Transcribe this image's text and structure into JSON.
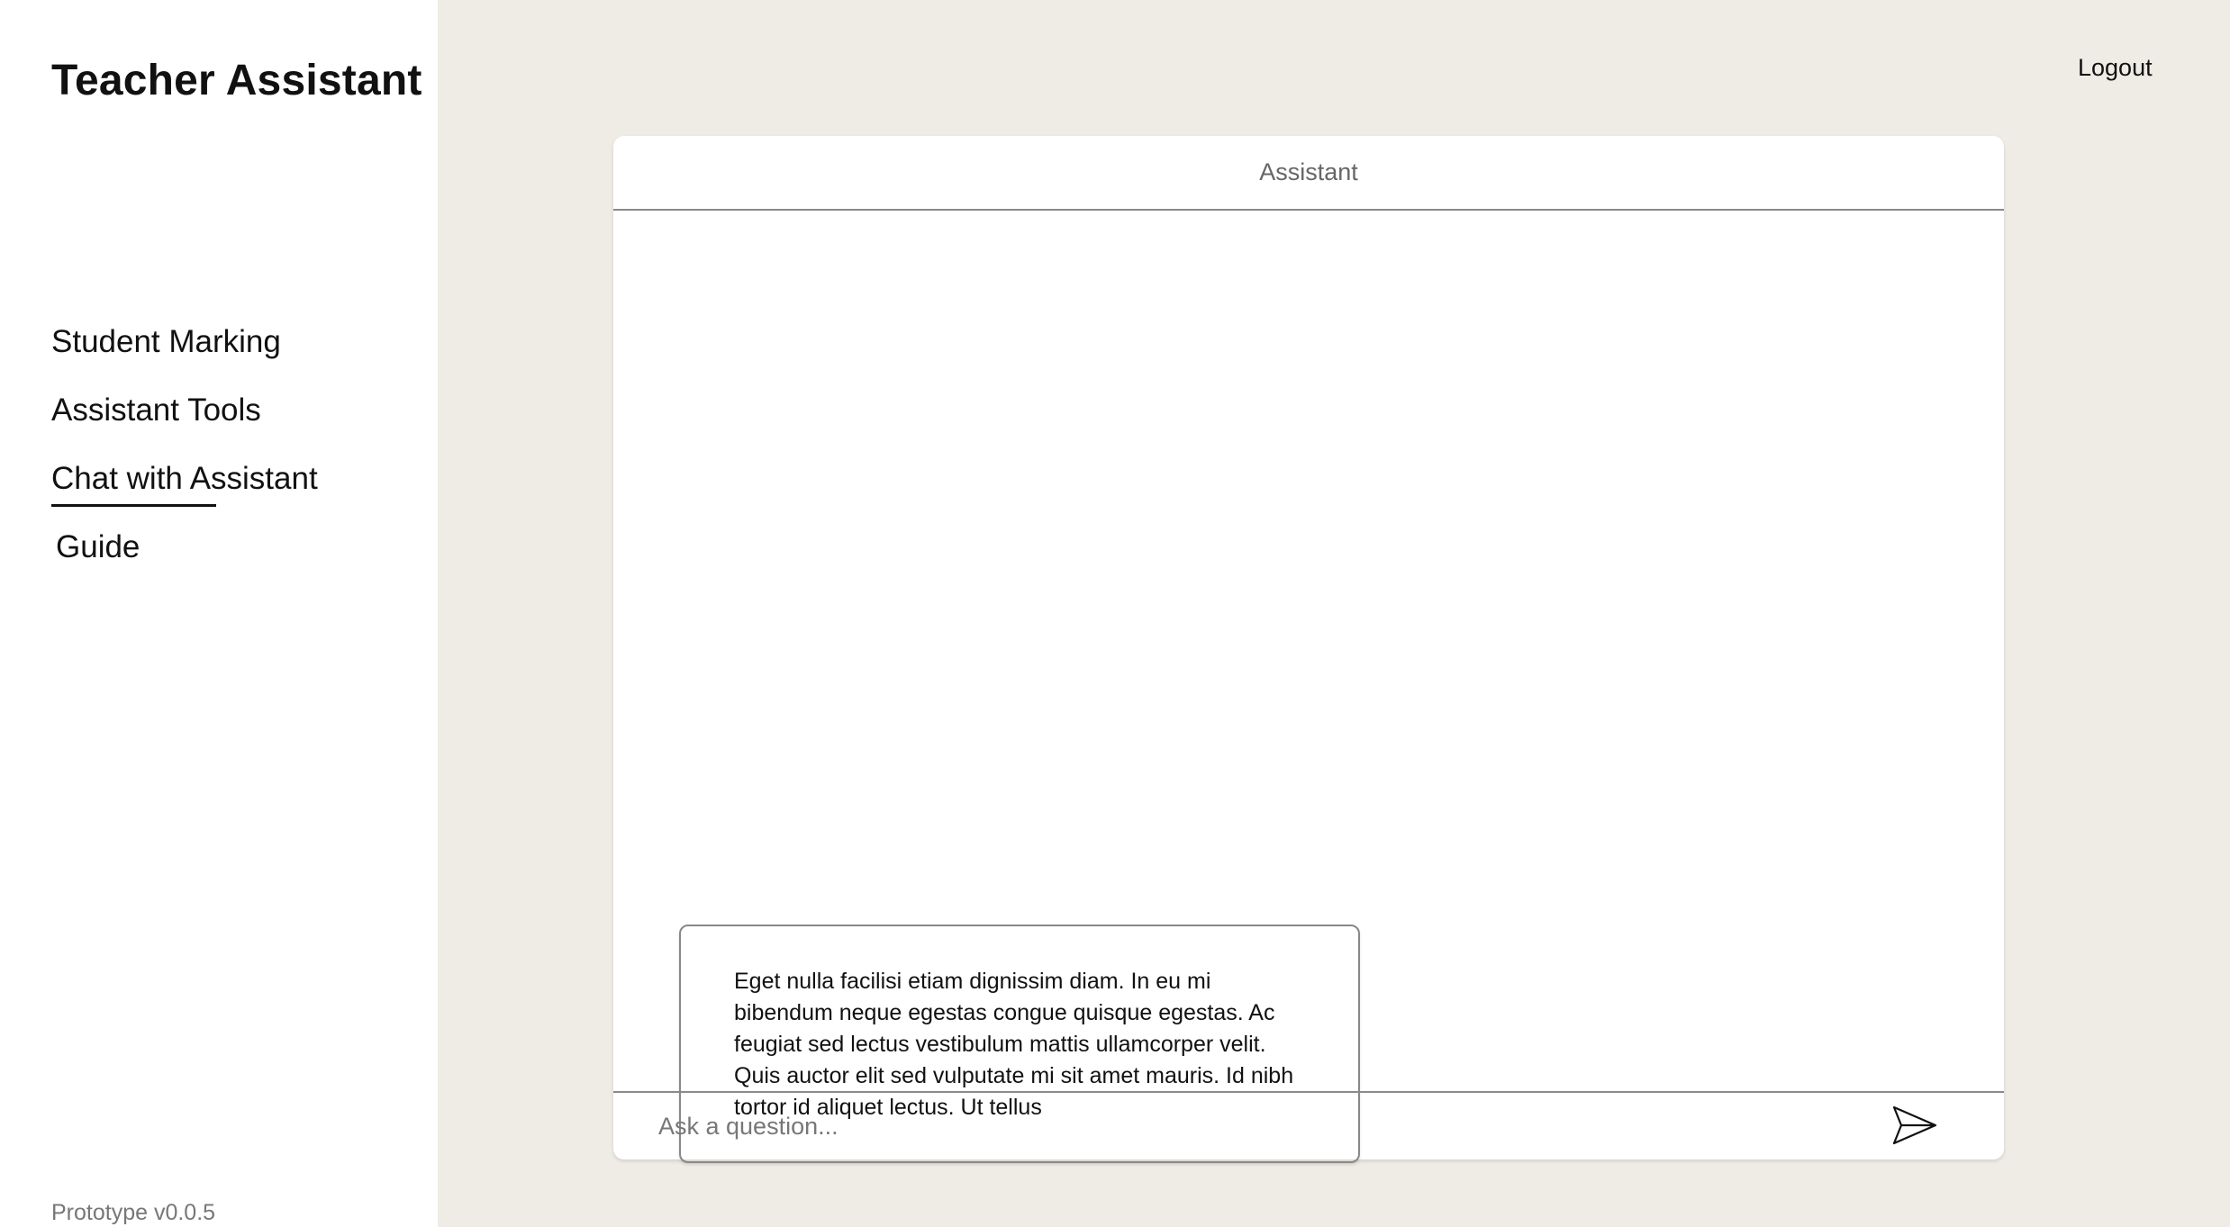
{
  "app": {
    "title": "Teacher Assistant",
    "version": "Prototype v0.0.5"
  },
  "nav": {
    "items": [
      {
        "label": "Student Marking",
        "active": false
      },
      {
        "label": "Assistant Tools",
        "active": false
      },
      {
        "label": "Chat with Assistant",
        "active": true
      },
      {
        "label": "Guide",
        "active": false
      }
    ]
  },
  "header": {
    "logout_label": "Logout"
  },
  "chat": {
    "title": "Assistant",
    "messages": [
      {
        "text": "Eget nulla facilisi etiam dignissim diam. In eu mi bibendum neque egestas congue quisque egestas. Ac feugiat sed lectus vestibulum mattis ullamcorper velit. Quis auctor elit sed vulputate mi sit amet mauris. Id nibh tortor id aliquet lectus. Ut tellus"
      }
    ],
    "input": {
      "value": "",
      "placeholder": "Ask a question..."
    },
    "send_icon": "send-icon"
  },
  "colors": {
    "page_background": "#efece6",
    "sidebar_background": "#ffffff",
    "panel_background": "#ffffff",
    "divider": "#8a8a8a"
  }
}
